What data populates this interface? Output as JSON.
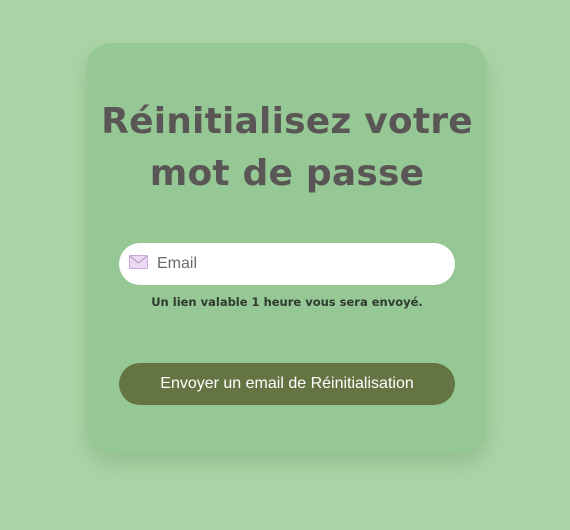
{
  "form": {
    "title": "Réinitialisez votre mot de passe",
    "email_placeholder": "Email",
    "email_icon": "envelope-icon",
    "hint": "Un lien valable 1 heure vous sera envoyé.",
    "submit_label": "Envoyer un email de Réinitialisation"
  },
  "colors": {
    "page_background": "#acd5a7",
    "card_background": "#95c895",
    "title_text": "#5a5656",
    "button_background": "#647543",
    "button_text": "#ffffff"
  }
}
